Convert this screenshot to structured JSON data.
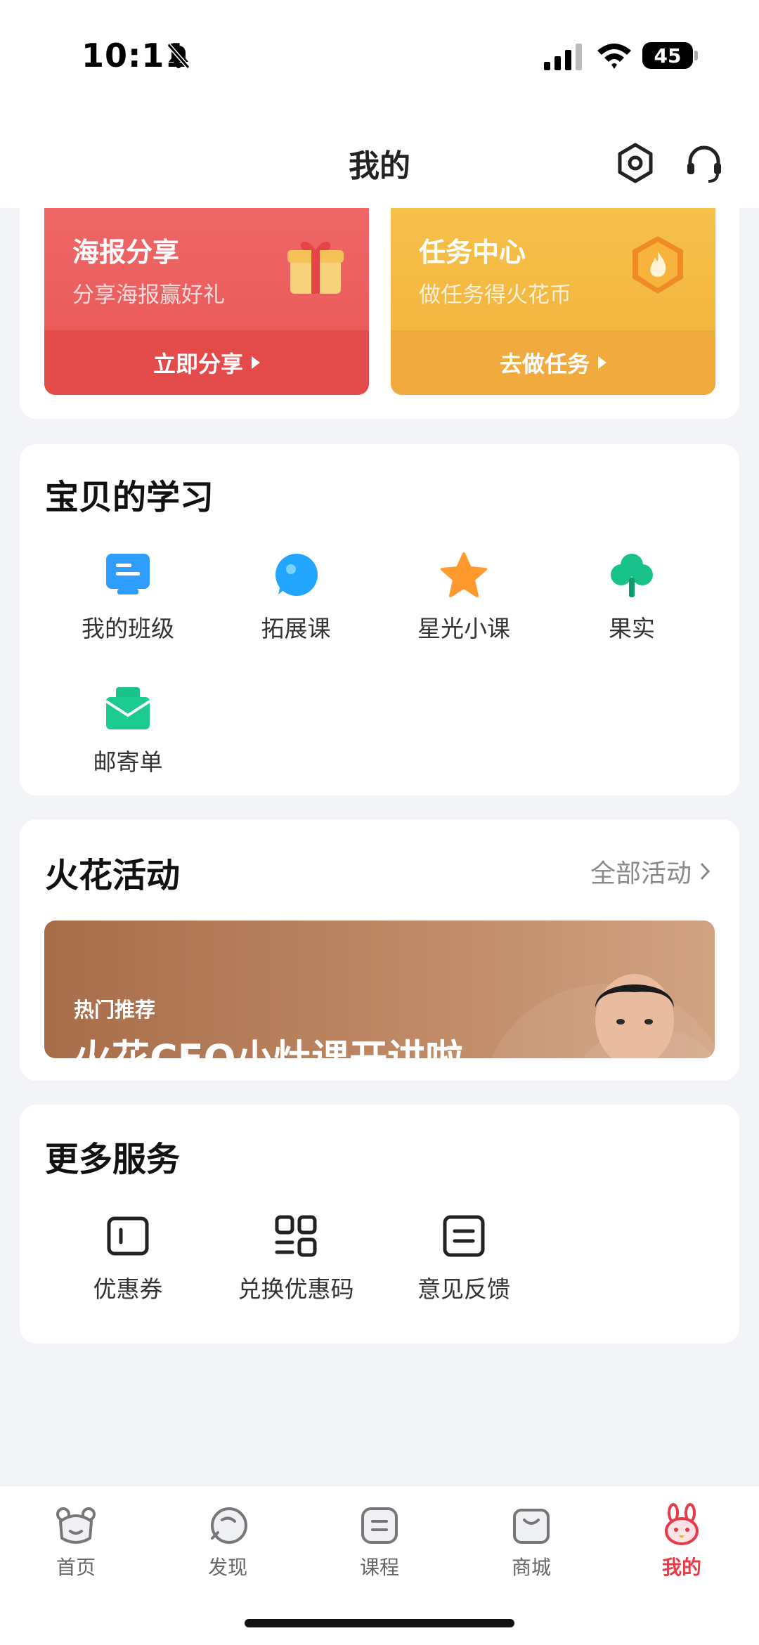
{
  "status": {
    "time": "10:11",
    "battery": "45"
  },
  "header": {
    "title": "我的"
  },
  "promo": {
    "poster": {
      "title": "海报分享",
      "subtitle": "分享海报赢好礼",
      "action": "立即分享"
    },
    "tasks": {
      "title": "任务中心",
      "subtitle": "做任务得火花币",
      "action": "去做任务"
    }
  },
  "learning": {
    "title": "宝贝的学习",
    "items": [
      {
        "label": "我的班级",
        "icon": "class-icon"
      },
      {
        "label": "拓展课",
        "icon": "extension-course-icon"
      },
      {
        "label": "星光小课",
        "icon": "star-icon"
      },
      {
        "label": "果实",
        "icon": "tree-icon"
      },
      {
        "label": "邮寄单",
        "icon": "mail-icon"
      }
    ]
  },
  "activities": {
    "title": "火花活动",
    "more": "全部活动",
    "banner": {
      "tag": "热门推荐",
      "title": "火花CEO小灶课开讲啦"
    }
  },
  "services": {
    "title": "更多服务",
    "items": [
      {
        "label": "优惠券",
        "icon": "coupon-icon"
      },
      {
        "label": "兑换优惠码",
        "icon": "redeem-code-icon"
      },
      {
        "label": "意见反馈",
        "icon": "feedback-icon"
      }
    ]
  },
  "tabs": [
    {
      "label": "首页",
      "icon": "home-bear-icon"
    },
    {
      "label": "发现",
      "icon": "discover-icon"
    },
    {
      "label": "课程",
      "icon": "course-icon"
    },
    {
      "label": "商城",
      "icon": "shop-icon"
    },
    {
      "label": "我的",
      "icon": "profile-bunny-icon",
      "active": true
    }
  ],
  "colors": {
    "accent": "#e83b4a",
    "promo_red": "#e85656",
    "promo_orange": "#f2b13b"
  }
}
